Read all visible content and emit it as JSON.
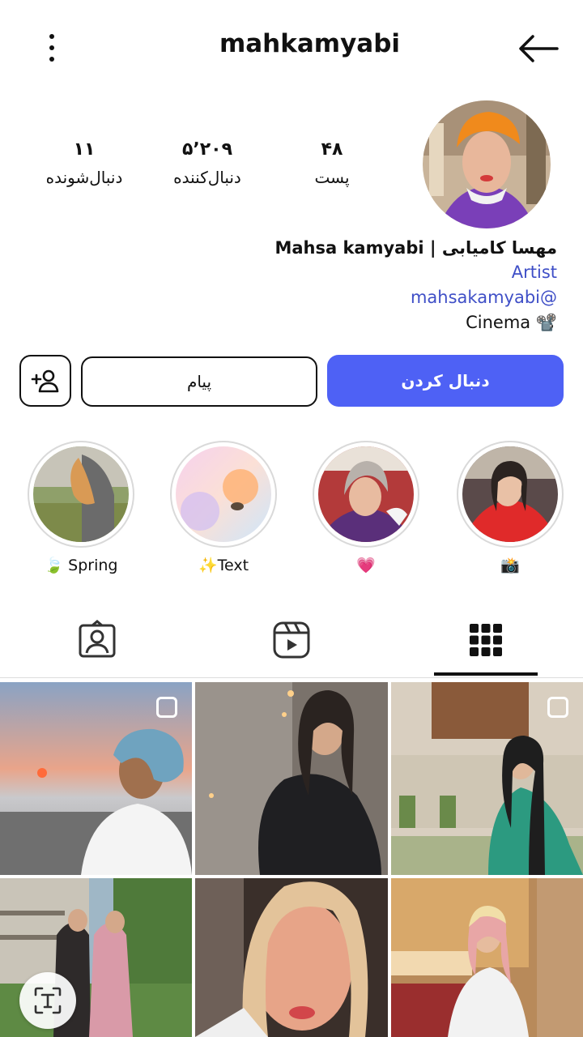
{
  "header": {
    "username": "mahkamyabi"
  },
  "stats": [
    {
      "value": "۴۸",
      "label": "پست"
    },
    {
      "value": "۵٬۲۰۹",
      "label": "دنبال‌کننده"
    },
    {
      "value": "۱۱",
      "label": "دنبال‌شونده"
    }
  ],
  "bio": {
    "name": "Mahsa kamyabi | مهسا کامیابی",
    "category": "Artist",
    "handle": "mahsakamyabi@",
    "line": "Cinema 📽️"
  },
  "buttons": {
    "follow": "دنبال کردن",
    "message": "پیام"
  },
  "highlights": [
    {
      "label": "📸"
    },
    {
      "label": "💗"
    },
    {
      "label": "✨Text"
    },
    {
      "label": "🍃 Spring"
    }
  ],
  "tabs": [
    "posts-grid",
    "reels",
    "tagged"
  ],
  "icons": {
    "back": "back-arrow-icon",
    "menu": "more-vertical-icon",
    "add_person": "add-person-icon",
    "text": "text-recognition-icon"
  },
  "colors": {
    "accent": "#4e61f5",
    "link": "#3f4fc7"
  }
}
